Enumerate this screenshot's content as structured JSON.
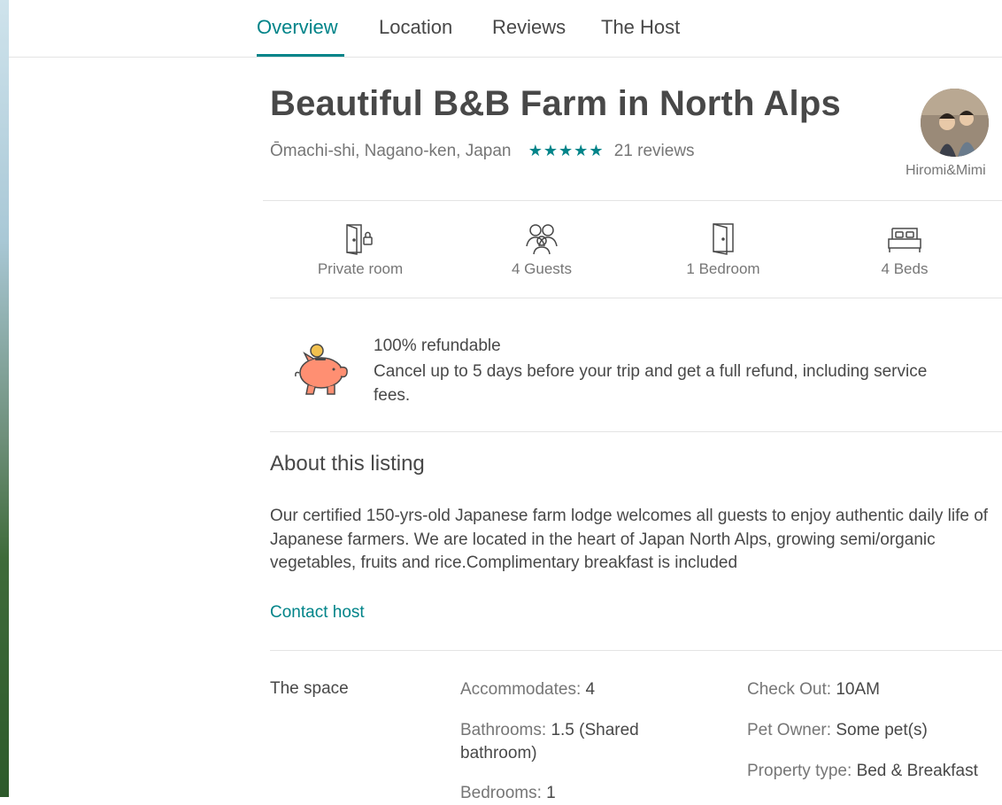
{
  "nav": {
    "tabs": [
      {
        "label": "Overview",
        "active": true
      },
      {
        "label": "Location",
        "active": false
      },
      {
        "label": "Reviews",
        "active": false
      },
      {
        "label": "The Host",
        "active": false
      }
    ]
  },
  "listing": {
    "title": "Beautiful B&B Farm in North Alps",
    "location": "Ōmachi-shi, Nagano-ken, Japan",
    "stars": "★★★★★",
    "rating_count": 5,
    "reviews": "21 reviews",
    "host_name": "Hiromi&Mimi"
  },
  "amenities": [
    {
      "label": "Private room",
      "icon": "private-room-icon"
    },
    {
      "label": "4 Guests",
      "icon": "guests-icon"
    },
    {
      "label": "1 Bedroom",
      "icon": "bedroom-door-icon"
    },
    {
      "label": "4 Beds",
      "icon": "bed-icon"
    }
  ],
  "refund": {
    "title": "100% refundable",
    "description": "Cancel up to 5 days before your trip and get a full refund, including service fees.",
    "icon": "piggy-bank-icon"
  },
  "about": {
    "title": "About this listing",
    "description": "Our certified 150-yrs-old Japanese farm lodge welcomes all guests to enjoy authentic daily life of Japanese farmers. We are located in the heart of Japan North Alps, growing semi/organic vegetables, fruits and rice.Complimentary breakfast is included",
    "contact_label": "Contact host"
  },
  "space": {
    "label": "The space",
    "col1": [
      {
        "key": "Accommodates:",
        "value": "4"
      },
      {
        "key": "Bathrooms:",
        "value": "1.5 (Shared bathroom)"
      },
      {
        "key": "Bedrooms:",
        "value": "1"
      }
    ],
    "col2": [
      {
        "key": "Check Out:",
        "value": "10AM"
      },
      {
        "key": "Pet Owner:",
        "value": "Some pet(s)"
      },
      {
        "key": "Property type:",
        "value": "Bed & Breakfast"
      }
    ]
  },
  "colors": {
    "accent": "#008489",
    "text": "#484848",
    "muted": "#767676",
    "piggy": "#ff8f72"
  }
}
